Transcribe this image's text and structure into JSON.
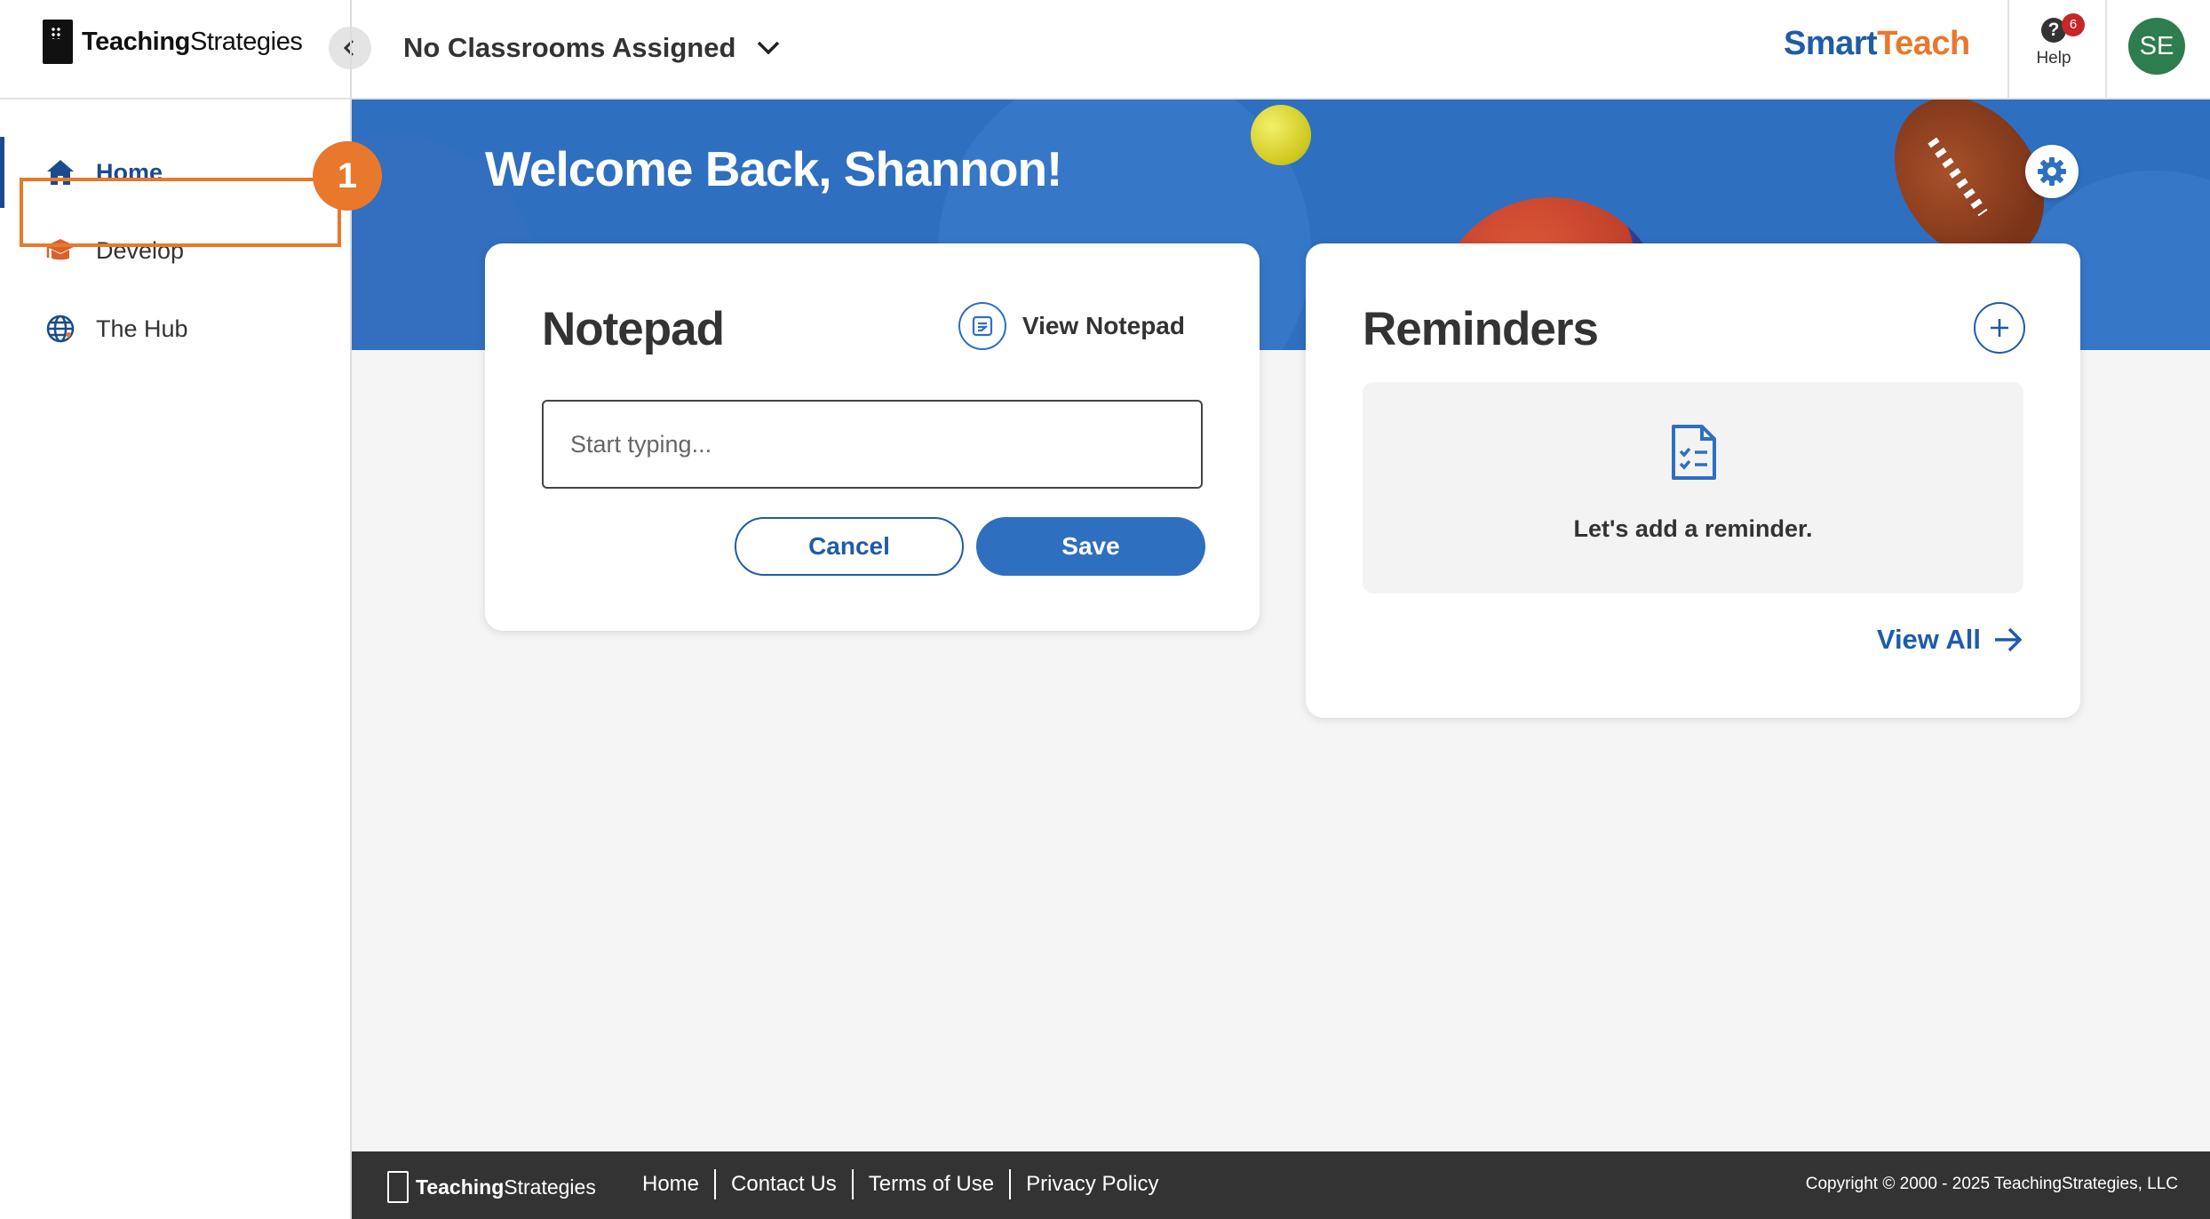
{
  "header": {
    "logo_text_bold": "Teaching",
    "logo_text_light": "Strategies",
    "classroom_selector": "No Classrooms Assigned",
    "brand_part1": "Smart",
    "brand_part2": "Teach",
    "help_label": "Help",
    "help_badge_count": "6",
    "avatar_initials": "SE"
  },
  "sidebar": {
    "items": [
      {
        "label": "Home",
        "icon": "home-icon",
        "active": true
      },
      {
        "label": "Develop",
        "icon": "graduation-cap-icon"
      },
      {
        "label": "The Hub",
        "icon": "globe-icon"
      }
    ],
    "step_badge": "1"
  },
  "hero": {
    "welcome": "Welcome Back, Shannon!"
  },
  "notepad": {
    "title": "Notepad",
    "view_link": "View Notepad",
    "input_placeholder": "Start typing...",
    "input_value": "",
    "cancel_label": "Cancel",
    "save_label": "Save"
  },
  "reminders": {
    "title": "Reminders",
    "empty_text": "Let's add a reminder.",
    "view_all": "View All"
  },
  "footer": {
    "logo_text_bold": "Teaching",
    "logo_text_light": "Strategies",
    "links": [
      "Home",
      "Contact Us",
      "Terms of Use",
      "Privacy Policy"
    ],
    "copyright": "Copyright © 2000 - 2025 TeachingStrategies, LLC"
  },
  "colors": {
    "primary_blue": "#2f6fc0",
    "dark_blue": "#1b4b8f",
    "accent_orange": "#e8782c",
    "avatar_green": "#2e7d4f",
    "badge_red": "#c62828",
    "footer_bg": "#333333"
  }
}
